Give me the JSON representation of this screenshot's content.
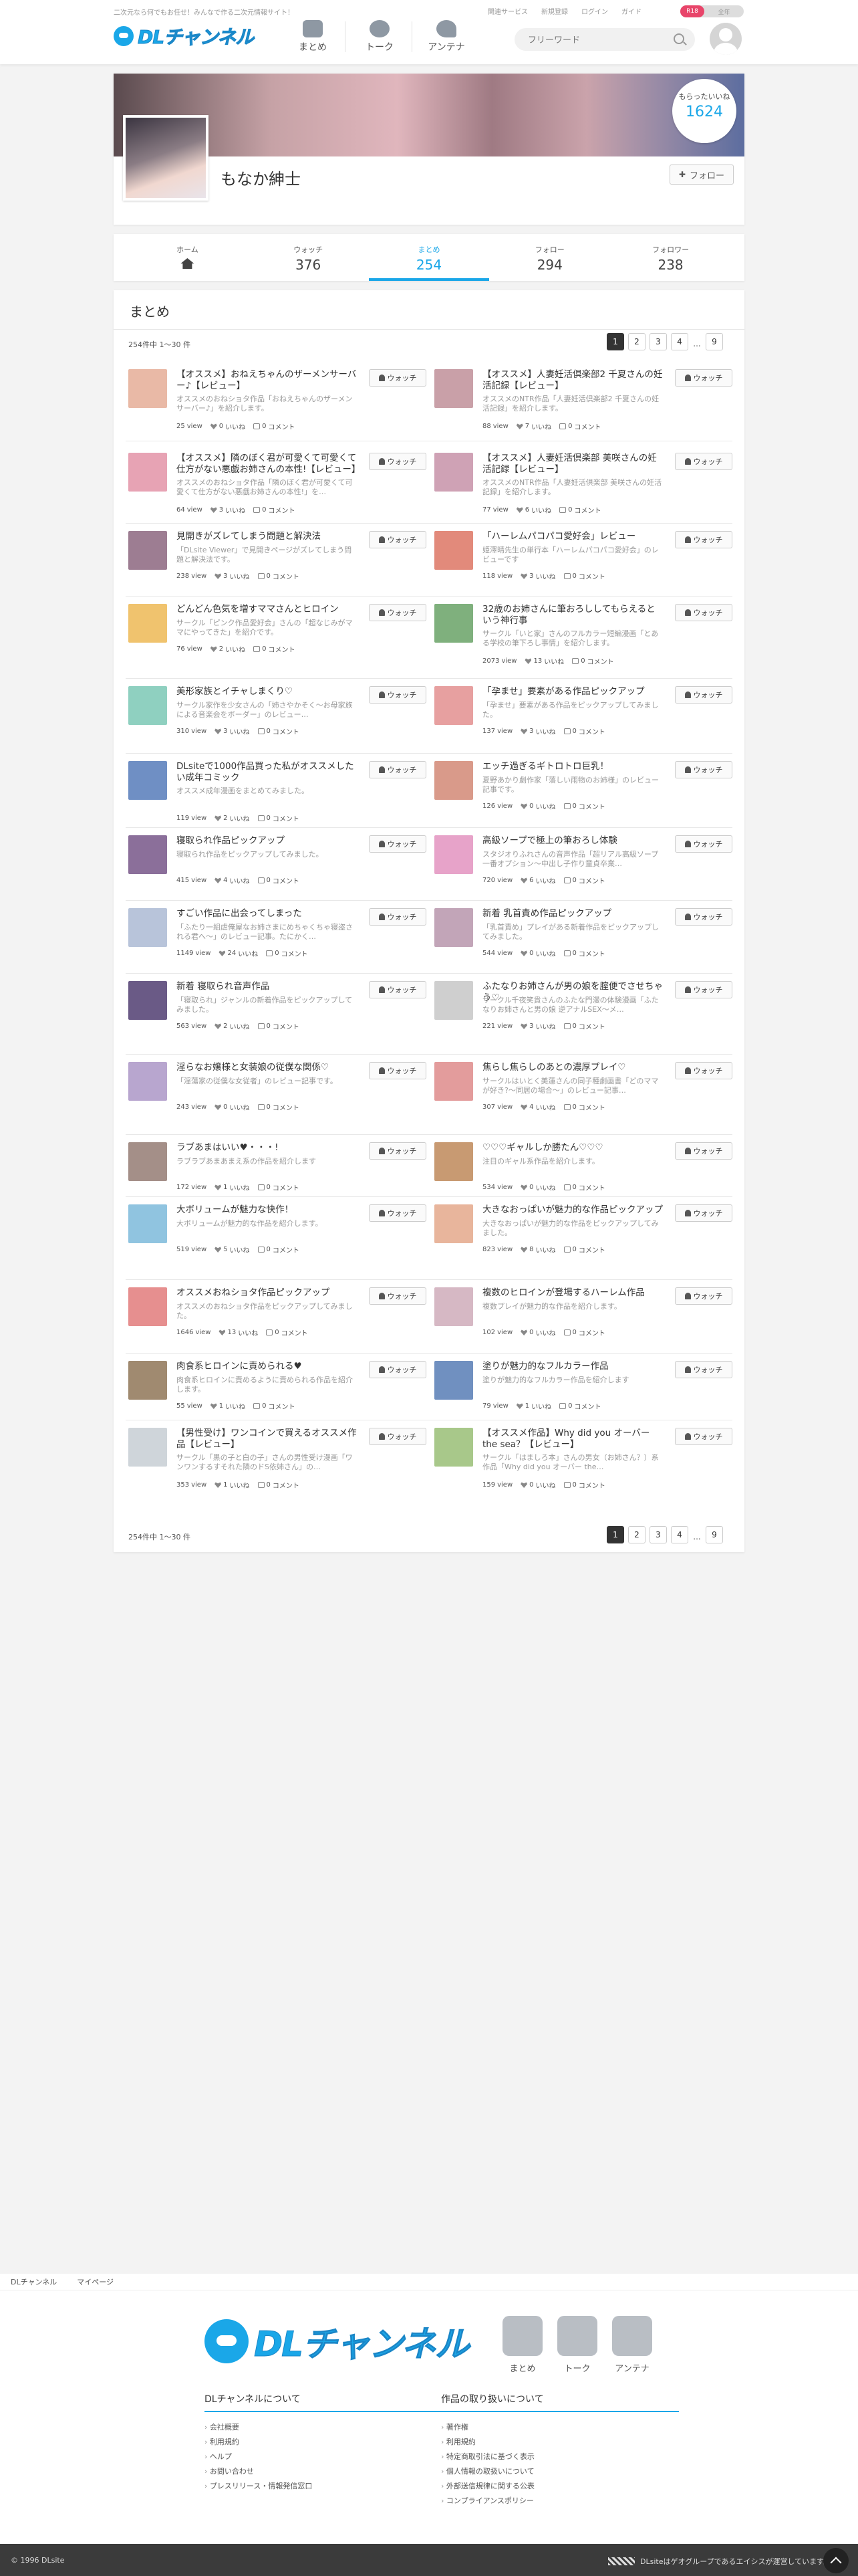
{
  "header": {
    "tagline": "二次元なら何でもお任せ！みんなで作る二次元情報サイト！",
    "toplinks": [
      "関連サービス",
      "新規登録",
      "ログイン",
      "ガイド"
    ],
    "logo_text": "DLチャンネル",
    "nav": [
      "まとめ",
      "トーク",
      "アンテナ"
    ],
    "toggle_on": "R18",
    "toggle_off": "全年",
    "search_placeholder": "フリーワード"
  },
  "profile": {
    "name": "もなか紳士",
    "likes_label": "もらったいいね",
    "likes_value": "1624",
    "follow_label": "フォロー"
  },
  "tabs": [
    {
      "label": "ホーム",
      "value": ""
    },
    {
      "label": "ウォッチ",
      "value": "376"
    },
    {
      "label": "まとめ",
      "value": "254"
    },
    {
      "label": "フォロー",
      "value": "294"
    },
    {
      "label": "フォロワー",
      "value": "238"
    }
  ],
  "main": {
    "title": "まとめ",
    "count": "254件中 1〜30 件",
    "pages": [
      "1",
      "2",
      "3",
      "4",
      "...",
      "9"
    ],
    "watch_label": "ウォッチ",
    "view_suffix": "view",
    "like_suffix": "いいね",
    "comment_suffix": "コメント"
  },
  "articles": [
    {
      "title": "【オススメ】おねえちゃんのザーメンサーバー♪【レビュー】",
      "desc": "オススメのおねショタ作品「おねえちゃんのザーメンサーバー♪」を紹介します。",
      "views": "25",
      "likes": "0",
      "comments": "0",
      "color": "#e9b9a6"
    },
    {
      "title": "【オススメ】人妻妊活倶楽部2 千夏さんの妊活記録【レビュー】",
      "desc": "オススメのNTR作品「人妻妊活倶楽部2 千夏さんの妊活記録」を紹介します。",
      "views": "88",
      "likes": "7",
      "comments": "0",
      "color": "#c9a0a8"
    },
    {
      "title": "【オススメ】隣のぼく君が可愛くて可愛くて仕方がない悪戯お姉さんの本性!【レビュー】",
      "desc": "オススメのおねショタ作品「隣のぼく君が可愛くて可愛くて仕方がない悪戯お姉さんの本性!」を…",
      "views": "64",
      "likes": "3",
      "comments": "0",
      "color": "#e7a3b4"
    },
    {
      "title": "【オススメ】人妻妊活倶楽部 美咲さんの妊活記録【レビュー】",
      "desc": "オススメのNTR作品「人妻妊活倶楽部 美咲さんの妊活記録」を紹介します。",
      "views": "77",
      "likes": "6",
      "comments": "0",
      "color": "#cfa2b5"
    },
    {
      "title": "見開きがズレてしまう問題と解決法",
      "desc": "「DLsite Viewer」で見開きページがズレてしまう問題と解決法です。",
      "views": "238",
      "likes": "3",
      "comments": "0",
      "color": "#9d7d92"
    },
    {
      "title": "「ハーレムパコパコ愛好会」レビュー",
      "desc": "姫澤晴先生の単行本「ハーレムパコパコ愛好会」のレビューです",
      "views": "118",
      "likes": "3",
      "comments": "0",
      "color": "#e28a7b"
    },
    {
      "title": "どんどん色気を増すママさんとヒロイン",
      "desc": "サークル「ピンク作品愛好会」さんの「超なじみがママにやってきた」を紹介です。",
      "views": "76",
      "likes": "2",
      "comments": "0",
      "color": "#f0c36e"
    },
    {
      "title": "32歳のお姉さんに筆おろししてもらえるという神行事",
      "desc": "サークル「いと家」さんのフルカラー短編漫画「とある学校の筆下ろし事情」を紹介します。",
      "views": "2073",
      "likes": "13",
      "comments": "0",
      "color": "#7fb07d"
    },
    {
      "title": "美形家族とイチャしまくり♡",
      "desc": "サークル家作を少女さんの「姉さやかそく～お母家族による音楽会をボーダー」のレビュー…",
      "views": "310",
      "likes": "3",
      "comments": "0",
      "color": "#8fd0c0"
    },
    {
      "title": "「孕ませ」要素がある作品ピックアップ",
      "desc": "「孕ませ」要素がある作品をピックアップしてみました。",
      "views": "137",
      "likes": "3",
      "comments": "0",
      "color": "#e7a0a0"
    },
    {
      "title": "DLsiteで1000作品買った私がオススメしたい成年コミック",
      "desc": "オススメ成年漫画をまとめてみました。",
      "views": "119",
      "likes": "2",
      "comments": "0",
      "color": "#6f8fc4"
    },
    {
      "title": "エッチ過ぎるギトロトロ巨乳！",
      "desc": "夏野あかり劇作家「落しい雨物のお姉様」のレビュー記事です。",
      "views": "126",
      "likes": "0",
      "comments": "0",
      "color": "#d99a8a"
    },
    {
      "title": "寝取られ作品ピックアップ",
      "desc": "寝取られ作品をピックアップしてみました。",
      "views": "415",
      "likes": "4",
      "comments": "0",
      "color": "#8b6f9a"
    },
    {
      "title": "高級ソープで極上の筆おろし体験",
      "desc": "スタジオりふれさんの音声作品「超リアル高級ソープ一番オプション〜中出し子作り童貞卒業…",
      "views": "720",
      "likes": "6",
      "comments": "0",
      "color": "#e7a3c9"
    },
    {
      "title": "すごい作品に出会ってしまった",
      "desc": "「ふたり一組虐俺屋なお姉さまにめちゃくちゃ寝盗される君へ〜」のレビュー記事。たにかく…",
      "views": "1149",
      "likes": "24",
      "comments": "0",
      "color": "#b8c4da"
    },
    {
      "title": "新着 乳首責め作品ピックアップ",
      "desc": "「乳首責め」プレイがある新着作品をピックアップしてみました。",
      "views": "544",
      "likes": "0",
      "comments": "0",
      "color": "#c2a5b8"
    },
    {
      "title": "新着 寝取られ音声作品",
      "desc": "「寝取られ」ジャンルの新着作品をピックアップしてみました。",
      "views": "563",
      "likes": "2",
      "comments": "0",
      "color": "#6a5a86"
    },
    {
      "title": "ふたなりお姉さんが男の娘を腟便でさせちゃう♡",
      "desc": "サークル千夜笑貴さんのふたな門漫の体験漫画「ふたなりお姉さんと男の娘 逆アナルSEX～メ…",
      "views": "221",
      "likes": "3",
      "comments": "0",
      "color": "#cfcfcf"
    },
    {
      "title": "淫らなお嬢様と女装娘の従僕な関係♡",
      "desc": "「淫蕩家の従僕な女従者」のレビュー記事です。",
      "views": "243",
      "likes": "0",
      "comments": "0",
      "color": "#b8a6cf"
    },
    {
      "title": "焦らし焦らしのあとの濃厚プレイ♡",
      "desc": "サークルはいとく美蓮さんの同子種劇画書「どのママが好き?〜同居の場合〜」のレビュー記事…",
      "views": "307",
      "likes": "4",
      "comments": "0",
      "color": "#e39c9c"
    },
    {
      "title": "ラブあまはいい♥・・・!",
      "desc": "ラブラブあまあまえ系の作品を紹介します",
      "views": "172",
      "likes": "1",
      "comments": "0",
      "color": "#a48f88"
    },
    {
      "title": "♡♡♡ギャルしか勝たん♡♡♡",
      "desc": "注目のギャル系作品を紹介します。",
      "views": "534",
      "likes": "0",
      "comments": "0",
      "color": "#c89a72"
    },
    {
      "title": "大ボリュームが魅力な快作！",
      "desc": "大ボリュームが魅力的な作品を紹介します。",
      "views": "519",
      "likes": "5",
      "comments": "0",
      "color": "#90c4e0"
    },
    {
      "title": "大きなおっぱいが魅力的な作品ピックアップ",
      "desc": "大きなおっぱいが魅力的な作品をピックアップしてみました。",
      "views": "823",
      "likes": "8",
      "comments": "0",
      "color": "#e8b59c"
    },
    {
      "title": "オススメおねショタ作品ピックアップ",
      "desc": "オススメのおねショタ作品をピックアップしてみました。",
      "views": "1646",
      "likes": "13",
      "comments": "0",
      "color": "#e68f8f"
    },
    {
      "title": "複数のヒロインが登場するハーレム作品",
      "desc": "複数プレイが魅力的な作品を紹介します。",
      "views": "102",
      "likes": "0",
      "comments": "0",
      "color": "#d6b8c4"
    },
    {
      "title": "肉食系ヒロインに責められる♥",
      "desc": "肉食系ヒロインに責めるように責められる作品を紹介します。",
      "views": "55",
      "likes": "1",
      "comments": "0",
      "color": "#a08a70"
    },
    {
      "title": "塗りが魅力的なフルカラー作品",
      "desc": "塗りが魅力的なフルカラー作品を紹介します",
      "views": "79",
      "likes": "1",
      "comments": "0",
      "color": "#7090c0"
    },
    {
      "title": "【男性受け】ワンコインで買えるオススメ作品【レビュー】",
      "desc": "サークル「黒の子と白の子」さんの男性受け漫画「ワンワンするすそれた隣のドS依姉さん」の…",
      "views": "353",
      "likes": "1",
      "comments": "0",
      "color": "#cfd5da"
    },
    {
      "title": "【オススメ作品】Why did you オーバー the sea？【レビュー】",
      "desc": "サークル「はましろ本」さんの男女（お姉さん？）系作品「Why did you オーバー the…",
      "views": "159",
      "likes": "0",
      "comments": "0",
      "color": "#a8c88a"
    }
  ],
  "footer": {
    "bar_links": [
      "DLチャンネル",
      "マイページ"
    ],
    "nav": [
      "まとめ",
      "トーク",
      "アンテナ"
    ],
    "col1_title": "DLチャンネルについて",
    "col1_items": [
      "会社概要",
      "利用規約",
      "ヘルプ",
      "お問い合わせ",
      "プレスリリース・情報発信窓口"
    ],
    "col2_title": "作品の取り扱いについて",
    "col2_items": [
      "著作権",
      "利用規約",
      "特定商取引法に基づく表示",
      "個人情報の取扱いについて",
      "外部送信規律に関する公表",
      "コンプライアンスポリシー"
    ],
    "copyright": "© 1996 DLsite",
    "group_text": "DLsiteはゲオグループであるエイシスが運営しています。"
  }
}
